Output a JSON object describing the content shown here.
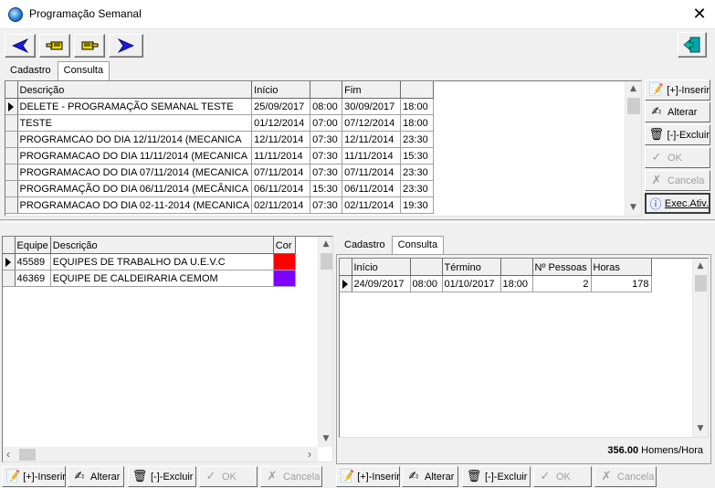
{
  "window": {
    "title": "Programação Semanal"
  },
  "upper_tabs": [
    "Cadastro",
    "Consulta"
  ],
  "schedule_grid": {
    "headers": [
      "Descrição",
      "Início",
      "",
      "Fim",
      ""
    ],
    "rows": [
      [
        "DELETE - PROGRAMAÇÃO SEMANAL TESTE",
        "25/09/2017",
        "08:00",
        "30/09/2017",
        "18:00"
      ],
      [
        "TESTE",
        "01/12/2014",
        "07:00",
        "07/12/2014",
        "18:00"
      ],
      [
        "PROGRAMCAO DO DIA 12/11/2014 (MECANICA",
        "12/11/2014",
        "07:30",
        "12/11/2014",
        "23:30"
      ],
      [
        "PROGRAMACAO DO DIA 11/11/2014 (MECANICA",
        "11/11/2014",
        "07:30",
        "11/11/2014",
        "15:30"
      ],
      [
        "PROGRAMACAO DO DIA 07/11/2014 (MECANICA",
        "07/11/2014",
        "07:30",
        "07/11/2014",
        "23:30"
      ],
      [
        "PROGRAMAÇÃO DO DIA 06/11/2014 (MECÂNICA",
        "06/11/2014",
        "15:30",
        "06/11/2014",
        "23:30"
      ],
      [
        "PROGRAMACAO DO DIA 02-11-2014 (MECANICA",
        "02/11/2014",
        "07:30",
        "02/11/2014",
        "19:30"
      ]
    ]
  },
  "side_buttons": {
    "insert": "[+]-Inserir",
    "edit": "Alterar",
    "delete": "[-]-Excluir",
    "ok": "OK",
    "cancel": "Cancela",
    "exec": "Exec.Ativ."
  },
  "teams_grid": {
    "headers": [
      "Equipe",
      "Descrição",
      "Cor"
    ],
    "rows": [
      {
        "code": "45589",
        "desc": "EQUIPES DE TRABALHO DA U.E.V.C",
        "color": "#ff0000"
      },
      {
        "code": "46369",
        "desc": "EQUIPE DE CALDEIRARIA CEMOM",
        "color": "#8000ff"
      }
    ]
  },
  "lower_tabs": [
    "Cadastro",
    "Consulta"
  ],
  "period_grid": {
    "headers": [
      "Início",
      "",
      "Término",
      "",
      "Nº Pessoas",
      "Horas"
    ],
    "rows": [
      [
        "24/09/2017",
        "08:00",
        "01/10/2017",
        "18:00",
        "2",
        "178"
      ]
    ]
  },
  "total": {
    "value": "356.00",
    "unit": "Homens/Hora"
  },
  "bottom_left_buttons": {
    "insert": "[+]-Inserir",
    "edit": "Alterar",
    "delete": "[-]-Excluir",
    "ok": "OK",
    "cancel": "Cancela"
  },
  "bottom_right_buttons": {
    "insert": "[+]-Inserir",
    "edit": "Alterar",
    "delete": "[-]-Excluir",
    "ok": "OK",
    "cancel": "Cancela"
  },
  "icons": {
    "first": "arrow-left-icon",
    "prev": "hand-left-icon",
    "next": "hand-right-icon",
    "last": "arrow-right-icon",
    "exit": "exit-door-icon"
  },
  "colors": {
    "nav_arrow": "#1a1adc",
    "hand": "#e8d000",
    "exit": "#009aa0"
  }
}
